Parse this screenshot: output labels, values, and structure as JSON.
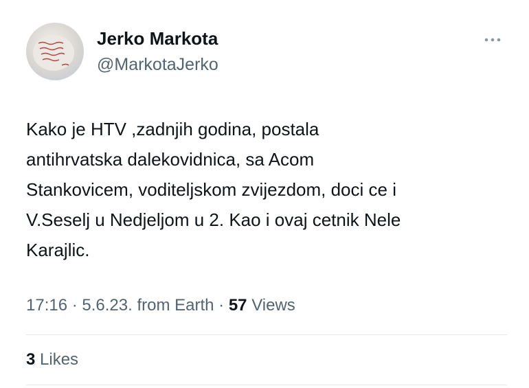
{
  "author": {
    "display_name": "Jerko Markota",
    "handle": "@MarkotaJerko",
    "avatar_icon": "avatar-photo-handwritten-note"
  },
  "more_icon": "more-options-icon",
  "tweet": {
    "lines": [
      "Kako je HTV ,zadnjih godina, postala",
      "antihrvatska dalekovidnica, sa Acom",
      "Stankovicem, voditeljskom zvijezdom, doci ce i",
      "V.Seselj u Nedjeljom u 2. Kao i ovaj cetnik Nele",
      "Karajlic."
    ]
  },
  "meta": {
    "time": "17:16",
    "sep1": " · ",
    "date": "5.6.23.",
    "source": " from Earth",
    "sep2": " · ",
    "views_count": "57",
    "views_label": " Views"
  },
  "stats": {
    "likes_count": "3",
    "likes_label": " Likes"
  },
  "colors": {
    "text": "#0f1419",
    "secondary": "#536471",
    "divider": "#e6e9ec"
  }
}
